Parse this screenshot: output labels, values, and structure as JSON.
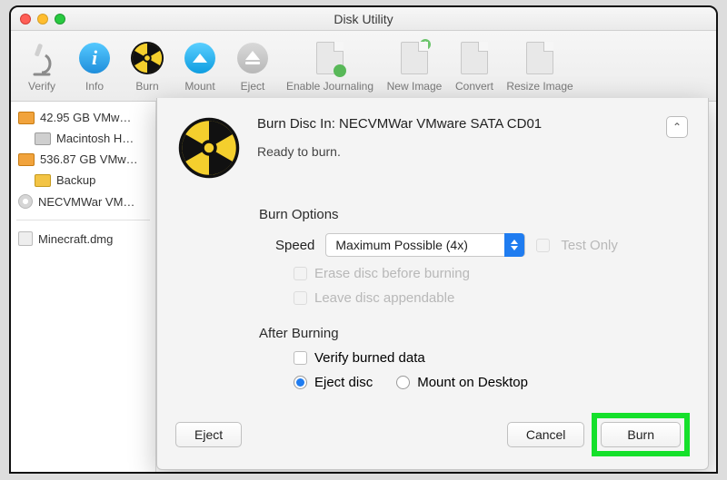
{
  "window": {
    "title": "Disk Utility"
  },
  "toolbar": {
    "verify": "Verify",
    "info": "Info",
    "burn": "Burn",
    "mount": "Mount",
    "eject": "Eject",
    "enable_journaling": "Enable Journaling",
    "new_image": "New Image",
    "convert": "Convert",
    "resize_image": "Resize Image"
  },
  "sidebar": {
    "items": [
      {
        "label": "42.95 GB VMw…"
      },
      {
        "label": "Macintosh H…"
      },
      {
        "label": "536.87 GB VMw…"
      },
      {
        "label": "Backup"
      },
      {
        "label": "NECVMWar VM…"
      }
    ],
    "images": [
      {
        "label": "Minecraft.dmg"
      }
    ]
  },
  "sheet": {
    "headline_prefix": "Burn Disc In:  ",
    "drive": "NECVMWar VMware SATA CD01",
    "status": "Ready to burn.",
    "burn_options_title": "Burn Options",
    "speed_label": "Speed",
    "speed_value": "Maximum Possible (4x)",
    "test_only": "Test Only",
    "erase": "Erase disc before burning",
    "appendable": "Leave disc appendable",
    "after_title": "After Burning",
    "verify": "Verify burned data",
    "eject": "Eject disc",
    "mount": "Mount on Desktop",
    "btn_eject": "Eject",
    "btn_cancel": "Cancel",
    "btn_burn": "Burn"
  }
}
